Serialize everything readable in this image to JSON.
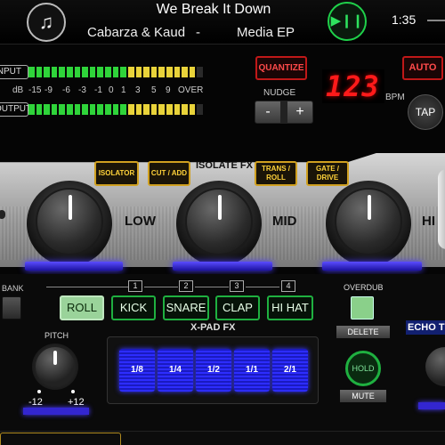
{
  "now_playing": {
    "title": "We Break It Down",
    "artist": "Cabarza & Kaud",
    "separator": "-",
    "album": "Media EP",
    "time": "1:35",
    "play_pause_icon": "play-pause-icon",
    "library_icon": "music-note-icon"
  },
  "meters": {
    "input_label": "INPUT",
    "output_label": "OUTPUT",
    "scale_labels": [
      "dB",
      "-15",
      "-9",
      "-6",
      "-3",
      "-1",
      "0",
      "1",
      "3",
      "5",
      "9",
      "OVER"
    ],
    "segments_lit": 22,
    "segments_total": 23
  },
  "quantize": {
    "label": "QUANTIZE"
  },
  "nudge": {
    "label": "NUDGE",
    "minus": "-",
    "plus": "+"
  },
  "tempo": {
    "bpm_display": "123",
    "bpm_unit": "BPM",
    "auto_label": "AUTO",
    "tap_label": "TAP"
  },
  "isolate_fx": {
    "title": "ISOLATE FX",
    "buttons": [
      "ISOLATOR",
      "CUT / ADD",
      "TRANS / ROLL",
      "GATE / DRIVE"
    ],
    "bands": [
      "LOW",
      "MID",
      "HI"
    ]
  },
  "bank": {
    "label": "BANK"
  },
  "pads": {
    "numbers": [
      "1",
      "2",
      "3",
      "4"
    ],
    "labels": [
      "ROLL",
      "KICK",
      "SNARE",
      "CLAP",
      "HI HAT"
    ],
    "active": "ROLL"
  },
  "xpad_fx": {
    "title": "X-PAD FX",
    "values": [
      "1/8",
      "1/4",
      "1/2",
      "1/1",
      "2/1"
    ]
  },
  "pitch": {
    "label": "PITCH",
    "min": "-12",
    "max": "+12"
  },
  "overdub": {
    "label": "OVERDUB",
    "delete_label": "DELETE",
    "hold_label": "HOLD",
    "mute_label": "MUTE"
  },
  "echo": {
    "label": "ECHO T"
  },
  "colors": {
    "accent_green": "#1fd14a",
    "accent_red": "#c01818",
    "accent_gold": "#d0a020",
    "accent_blue": "#4a3cff",
    "bpm_red": "#ff1a1a"
  }
}
